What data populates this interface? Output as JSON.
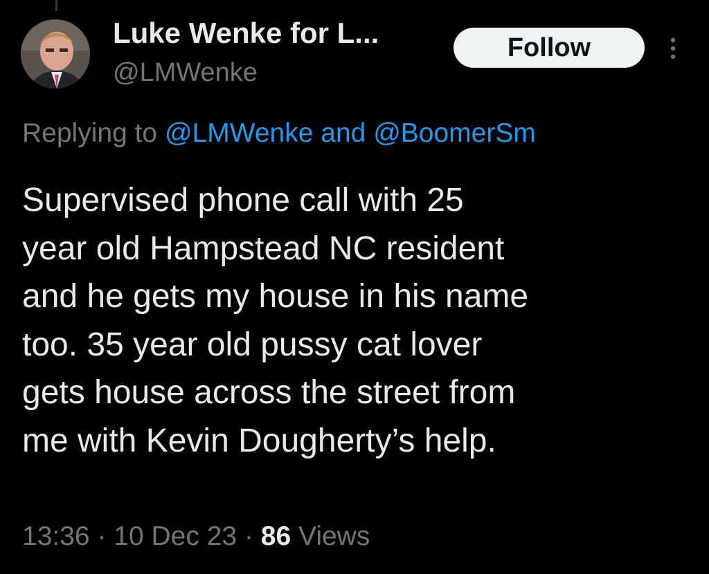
{
  "author": {
    "display_name": "Luke Wenke for L...",
    "handle": "@LMWenke"
  },
  "header": {
    "follow_label": "Follow",
    "more_icon": "more-vertical-icon"
  },
  "reply_context": {
    "prefix": "Replying to",
    "mention_1": "@LMWenke",
    "separator": "and",
    "mention_2": "@BoomerSm"
  },
  "tweet": {
    "lines": [
      "Supervised phone call with 25",
      "year old Hampstead NC resident",
      "and he gets my house in his name",
      "too.  35 year old pussy cat lover",
      "gets house across the street from",
      "me with Kevin Dougherty’s help."
    ]
  },
  "meta": {
    "time": "13:36",
    "dot_1": "·",
    "date": "10 Dec 23",
    "dot_2": "·",
    "views_count": "86",
    "views_label": "Views"
  },
  "colors": {
    "background": "#000000",
    "text_primary": "#e7e9ea",
    "text_secondary": "#71767b",
    "link": "#1d9bf0",
    "follow_bg": "#eff3f4"
  }
}
